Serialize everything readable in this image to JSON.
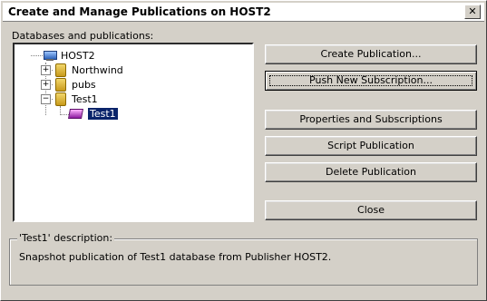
{
  "window": {
    "title": "Create and Manage Publications on HOST2",
    "close_glyph": "✕"
  },
  "left_panel": {
    "label": "Databases and publications:",
    "tree": {
      "root": "HOST2",
      "items": [
        {
          "label": "Northwind",
          "expander": "+"
        },
        {
          "label": "pubs",
          "expander": "+"
        },
        {
          "label": "Test1",
          "expander": "−"
        }
      ],
      "selected_publication": "Test1"
    }
  },
  "buttons": {
    "create": "Create Publication...",
    "push": "Push New Subscription...",
    "properties": "Properties and Subscriptions",
    "script": "Script Publication",
    "delete": "Delete Publication",
    "close": "Close"
  },
  "description": {
    "title": "'Test1' description:",
    "text": "Snapshot publication of Test1 database from Publisher HOST2."
  }
}
